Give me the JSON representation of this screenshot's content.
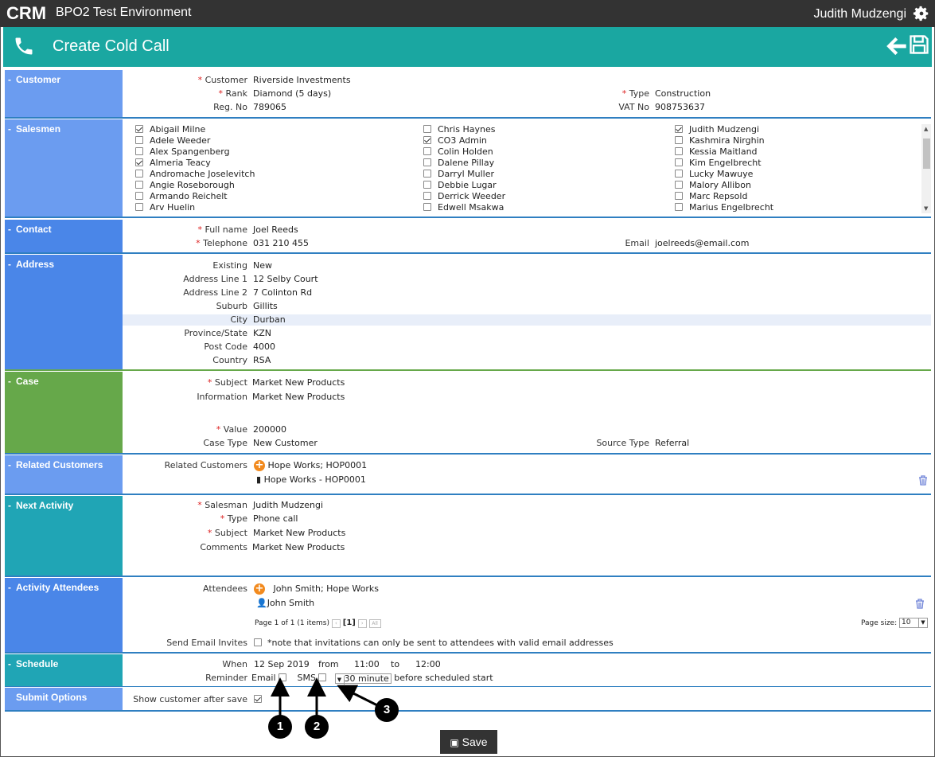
{
  "header": {
    "app_title": "BPO2 Test Environment",
    "user_name": "Judith Mudzengi",
    "logo_text": "CRM"
  },
  "title_bar": {
    "title": "Create Cold Call"
  },
  "customer": {
    "label": "Customer",
    "customer_label": "Customer",
    "customer": "Riverside Investments",
    "rank_label": "Rank",
    "rank": "Diamond (5 days)",
    "type_label": "Type",
    "type": "Construction",
    "reg_label": "Reg. No",
    "reg": "789065",
    "vat_label": "VAT No",
    "vat": "908753637"
  },
  "salesmen": {
    "label": "Salesmen",
    "col1": [
      {
        "name": "Abigail Milne",
        "checked": true
      },
      {
        "name": "Adele Weeder",
        "checked": false
      },
      {
        "name": "Alex Spangenberg",
        "checked": false
      },
      {
        "name": "Almeria Teacy",
        "checked": true
      },
      {
        "name": "Andromache Joselevitch",
        "checked": false
      },
      {
        "name": "Angie Roseborough",
        "checked": false
      },
      {
        "name": "Armando Reichelt",
        "checked": false
      },
      {
        "name": "Arv Huelin",
        "checked": false
      }
    ],
    "col2": [
      {
        "name": "Chris Haynes",
        "checked": false
      },
      {
        "name": "CO3 Admin",
        "checked": true
      },
      {
        "name": "Colin Holden",
        "checked": false
      },
      {
        "name": "Dalene Pillay",
        "checked": false
      },
      {
        "name": "Darryl Muller",
        "checked": false
      },
      {
        "name": "Debbie Lugar",
        "checked": false
      },
      {
        "name": "Derrick Weeder",
        "checked": false
      },
      {
        "name": "Edwell Msakwa",
        "checked": false
      }
    ],
    "col3": [
      {
        "name": "Judith Mudzengi",
        "checked": true
      },
      {
        "name": "Kashmira Nirghin",
        "checked": false
      },
      {
        "name": "Kessia Maitland",
        "checked": false
      },
      {
        "name": "Kim Engelbrecht",
        "checked": false
      },
      {
        "name": "Lucky Mawuye",
        "checked": false
      },
      {
        "name": "Malory Allibon",
        "checked": false
      },
      {
        "name": "Marc Repsold",
        "checked": false
      },
      {
        "name": "Marius Engelbrecht",
        "checked": false
      }
    ]
  },
  "contact": {
    "label": "Contact",
    "fullname_label": "Full name",
    "fullname": "Joel Reeds",
    "tel_label": "Telephone",
    "tel": "031 210 455",
    "email_label": "Email",
    "email": "joelreeds@email.com"
  },
  "address": {
    "label": "Address",
    "rows": [
      {
        "k": "Existing",
        "v": "New"
      },
      {
        "k": "Address Line 1",
        "v": "12 Selby Court"
      },
      {
        "k": "Address Line 2",
        "v": "7 Colinton Rd"
      },
      {
        "k": "Suburb",
        "v": "Gillits"
      },
      {
        "k": "City",
        "v": "Durban"
      },
      {
        "k": "Province/State",
        "v": "KZN"
      },
      {
        "k": "Post Code",
        "v": "4000"
      },
      {
        "k": "Country",
        "v": "RSA"
      }
    ]
  },
  "case": {
    "label": "Case",
    "subject_label": "Subject",
    "subject": "Market New Products",
    "info_label": "Information",
    "info": "Market New Products",
    "value_label": "Value",
    "value": "200000",
    "casetype_label": "Case Type",
    "casetype": "New Customer",
    "source_label": "Source Type",
    "source": "Referral"
  },
  "related": {
    "label": "Related Customers",
    "field_label": "Related Customers",
    "search": "Hope Works; HOP0001",
    "item": "Hope Works - HOP0001"
  },
  "next_activity": {
    "label": "Next Activity",
    "salesman_label": "Salesman",
    "salesman": "Judith Mudzengi",
    "type_label": "Type",
    "type": "Phone call",
    "subject_label": "Subject",
    "subject": "Market New Products",
    "comments_label": "Comments",
    "comments": "Market New Products"
  },
  "attendees": {
    "label": "Activity Attendees",
    "field_label": "Attendees",
    "search": "John Smith; Hope Works",
    "item": "John Smith",
    "pager": "Page 1 of 1 (1 items)",
    "current_page": "[1]",
    "page_size_label": "Page size:",
    "page_size": "10",
    "invites_label": "Send Email Invites",
    "invites_note": "*note that invitations can only be sent to attendees with valid email addresses"
  },
  "schedule": {
    "label": "Schedule",
    "when_label": "When",
    "date": "12 Sep 2019",
    "from_label": "from",
    "from": "11:00",
    "to_label": "to",
    "to": "12:00",
    "reminder_label": "Reminder",
    "email_label": "Email",
    "sms_label": "SMS",
    "minutes": "30 minute",
    "before": "before scheduled start"
  },
  "submit": {
    "label": "Submit Options",
    "show_label": "Show customer after save"
  },
  "callouts": [
    "1",
    "2",
    "3"
  ],
  "save_label": "Save",
  "colors": {
    "topbar": "#333333",
    "teal": "#1aa7a1",
    "label_blue": "#6b9cf0",
    "label_royal": "#4a86e8",
    "label_green": "#66a84a",
    "label_teal": "#20a5b5"
  }
}
